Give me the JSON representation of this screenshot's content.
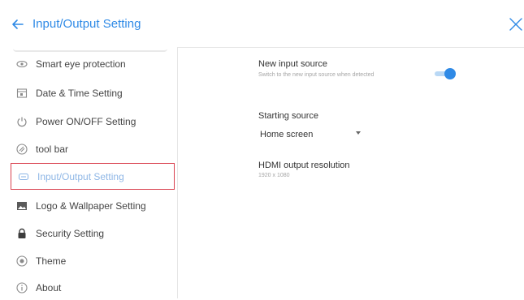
{
  "header": {
    "title": "Input/Output Setting",
    "back_icon": "arrow-left-icon",
    "close_icon": "close-icon",
    "accent_color": "#2f8ae6"
  },
  "sidebar": {
    "items": [
      {
        "label": "Smart eye protection",
        "icon": "eye-icon",
        "selected": false
      },
      {
        "label": "Date & Time Setting",
        "icon": "calendar-icon",
        "selected": false
      },
      {
        "label": "Power ON/OFF Setting",
        "icon": "power-icon",
        "selected": false
      },
      {
        "label": "tool bar",
        "icon": "toolbar-icon",
        "selected": false
      },
      {
        "label": "Input/Output Setting",
        "icon": "input-output-icon",
        "selected": true
      },
      {
        "label": "Logo & Wallpaper Setting",
        "icon": "image-icon",
        "selected": false
      },
      {
        "label": "Security Setting",
        "icon": "lock-icon",
        "selected": false
      },
      {
        "label": "Theme",
        "icon": "theme-icon",
        "selected": false
      },
      {
        "label": "About",
        "icon": "info-icon",
        "selected": false
      }
    ],
    "selected_border_color": "#d9414f"
  },
  "main": {
    "new_input_source": {
      "title": "New input source",
      "description": "Switch to the new input source when detected",
      "toggle_on": true
    },
    "starting_source": {
      "title": "Starting source",
      "selected_value": "Home screen"
    },
    "hdmi_output": {
      "title": "HDMI output resolution",
      "value": "1920 x 1080"
    }
  }
}
